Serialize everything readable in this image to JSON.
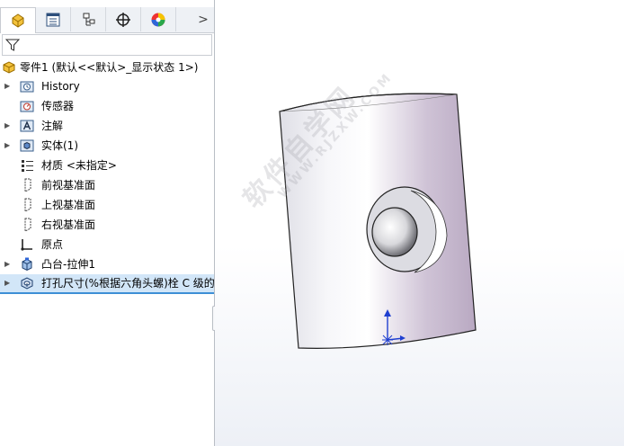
{
  "tabs": [
    {
      "icon": "feature-manager-icon",
      "active": true
    },
    {
      "icon": "property-manager-icon",
      "active": false
    },
    {
      "icon": "configuration-manager-icon",
      "active": false
    },
    {
      "icon": "dimxpert-icon",
      "active": false
    },
    {
      "icon": "display-manager-icon",
      "active": false
    }
  ],
  "tabs_more_label": ">",
  "filter_icon": "filter-icon",
  "tree": {
    "root": "零件1  (默认<<默认>_显示状态 1>)",
    "items": [
      {
        "label": "History",
        "icon": "history-icon",
        "expandable": true
      },
      {
        "label": "传感器",
        "icon": "sensor-icon",
        "expandable": false
      },
      {
        "label": "注解",
        "icon": "annotation-icon",
        "expandable": true
      },
      {
        "label": "实体(1)",
        "icon": "solid-bodies-icon",
        "expandable": true
      },
      {
        "label": "材质 <未指定>",
        "icon": "material-icon",
        "expandable": false
      },
      {
        "label": "前视基准面",
        "icon": "plane-icon",
        "expandable": false
      },
      {
        "label": "上视基准面",
        "icon": "plane-icon",
        "expandable": false
      },
      {
        "label": "右视基准面",
        "icon": "plane-icon",
        "expandable": false
      },
      {
        "label": "原点",
        "icon": "origin-icon",
        "expandable": false
      },
      {
        "label": "凸台-拉伸1",
        "icon": "boss-extrude-icon",
        "expandable": true
      },
      {
        "label": "打孔尺寸(%根据六角头螺)栓 C 级的",
        "icon": "hole-wizard-icon",
        "expandable": true,
        "selected": true
      }
    ]
  },
  "watermark": {
    "text": "软件自学网",
    "sub": "WWW.RJZXW.COM"
  },
  "colors": {
    "selection": "#d2e6f8",
    "selection_border": "#3e8fd6",
    "triad_blue": "#1f3fd0"
  }
}
